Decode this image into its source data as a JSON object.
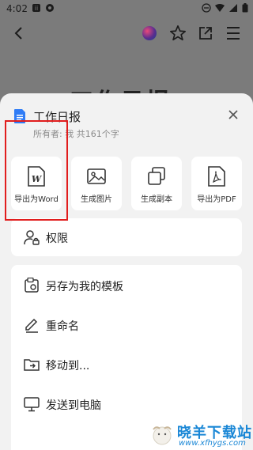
{
  "status": {
    "time": "4:02"
  },
  "background_heading": "工作日报",
  "sheet": {
    "title": "工作日报",
    "subtitle": "所有者: 我  共161个字"
  },
  "actions": [
    {
      "label": "导出为Word",
      "icon": "word-export-icon"
    },
    {
      "label": "生成图片",
      "icon": "image-icon"
    },
    {
      "label": "生成副本",
      "icon": "copy-icon"
    },
    {
      "label": "导出为PDF",
      "icon": "pdf-export-icon"
    }
  ],
  "permission": {
    "label": "权限",
    "icon": "user-lock-icon"
  },
  "menu": [
    {
      "label": "另存为我的模板",
      "icon": "template-icon"
    },
    {
      "label": "重命名",
      "icon": "pencil-icon"
    },
    {
      "label": "移动到...",
      "icon": "folder-move-icon"
    },
    {
      "label": "发送到电脑",
      "icon": "monitor-icon"
    }
  ],
  "watermark": {
    "text": "晓羊下载站",
    "url": "www.xfhygs.com"
  },
  "colors": {
    "highlight": "#e11d1d",
    "accent": "#1a87d6",
    "doc_icon": "#2f7cf6"
  }
}
